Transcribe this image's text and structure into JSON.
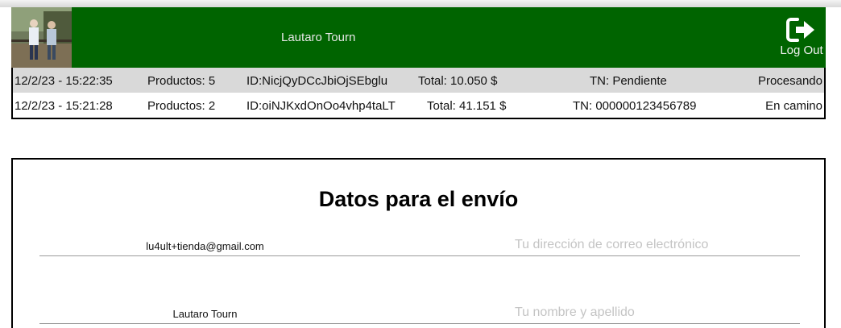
{
  "header": {
    "user_name": "Lautaro Tourn",
    "logout_label": "Log Out"
  },
  "orders": [
    {
      "datetime": "12/2/23 - 15:22:35",
      "products": "Productos: 5",
      "id": "ID:NicjQyDCcJbiOjSEbglu",
      "total": "Total: 10.050 $",
      "tracking": "TN: Pendiente",
      "status": "Procesando"
    },
    {
      "datetime": "12/2/23 - 15:21:28",
      "products": "Productos: 2",
      "id": "ID:oiNJKxdOnOo4vhp4taLT",
      "total": "Total: 41.151 $",
      "tracking": "TN: 000000123456789",
      "status": "En camino"
    }
  ],
  "shipping_form": {
    "title": "Datos para el envío",
    "email": {
      "value": "lu4ult+tienda@gmail.com",
      "placeholder": "Tu dirección de correo electrónico"
    },
    "name": {
      "value": "Lautaro Tourn",
      "placeholder": "Tu nombre y apellido"
    }
  },
  "colors": {
    "header_bg": "#006400",
    "row_alt_bg": "#d9d9d9"
  },
  "icons": {
    "logout": "sign-out-icon",
    "avatar": "user-photo"
  }
}
